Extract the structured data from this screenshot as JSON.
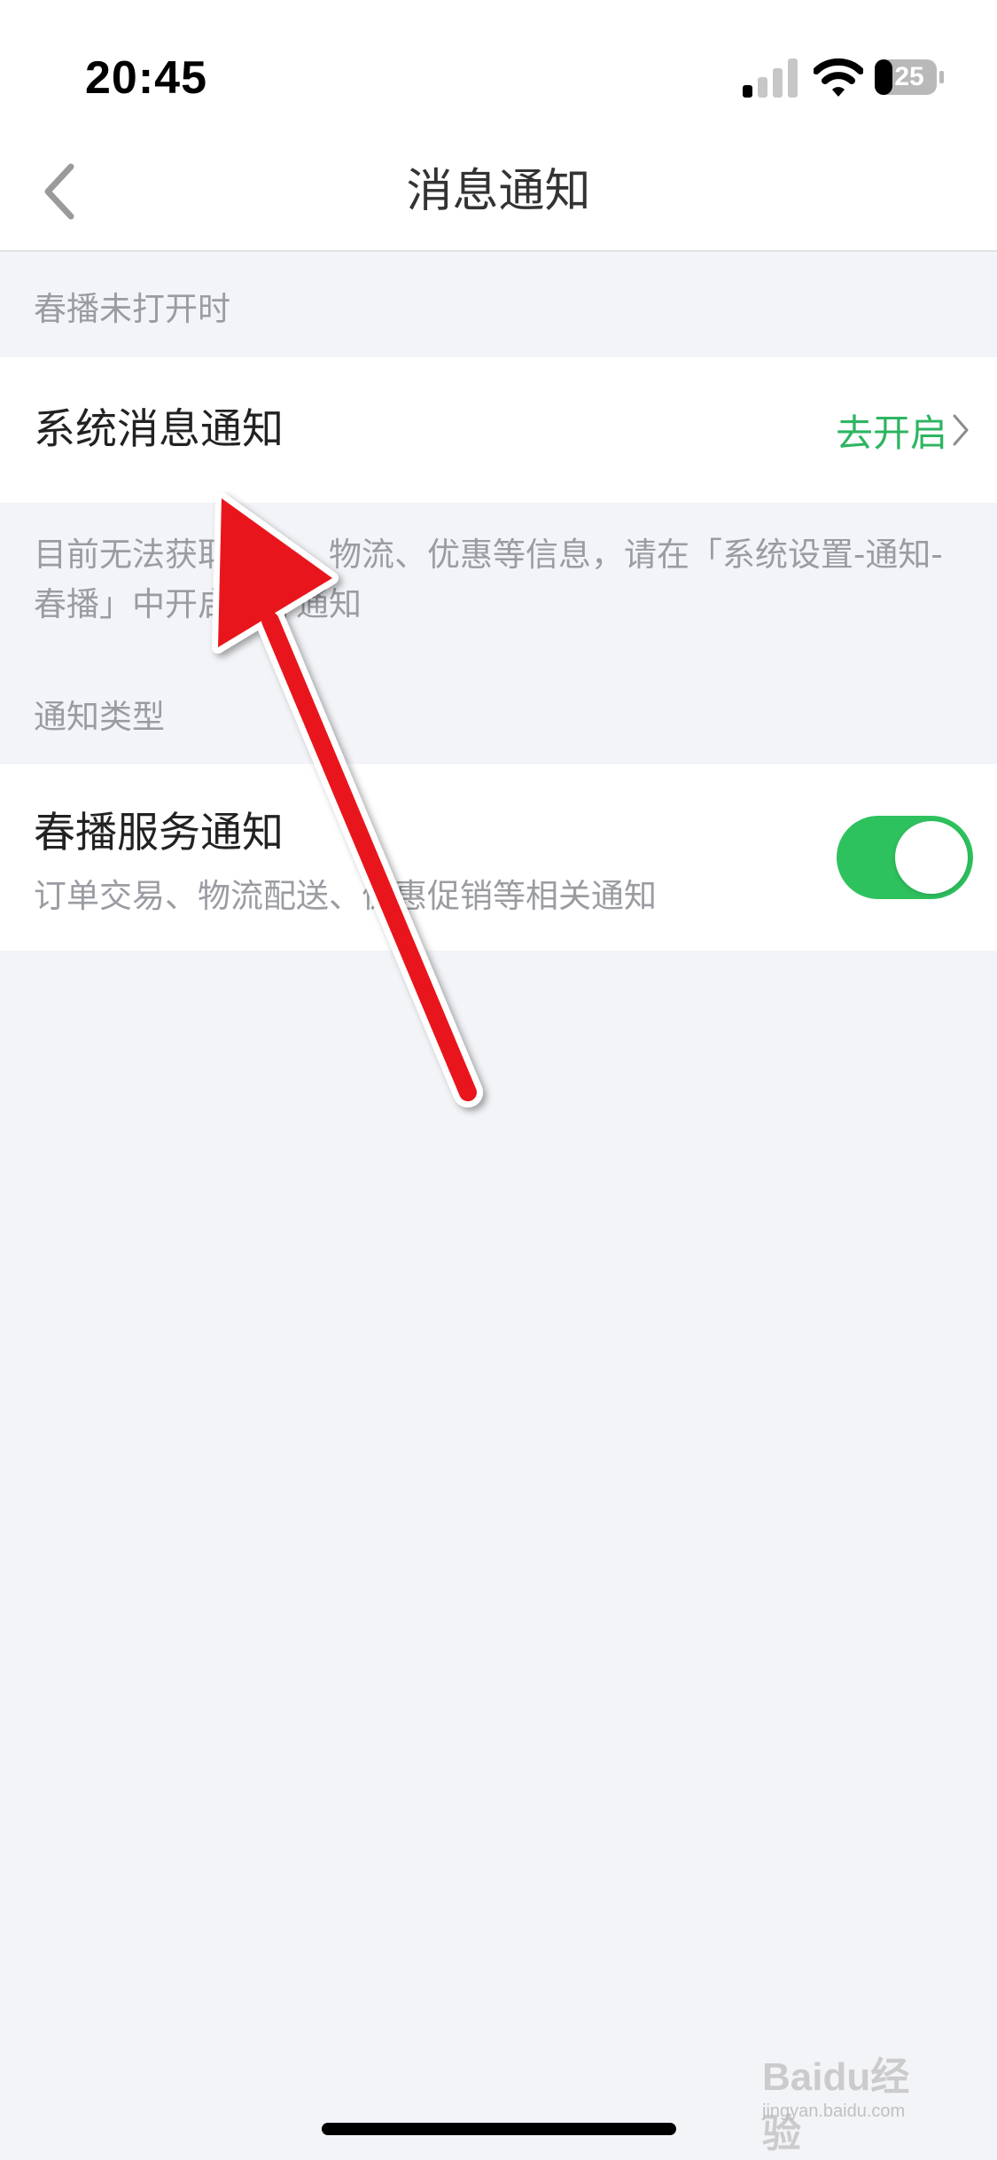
{
  "status_bar": {
    "time": "20:45",
    "battery_level": "25",
    "signal_icon": "cellular-signal-icon",
    "wifi_icon": "wifi-icon",
    "battery_icon": "battery-icon"
  },
  "nav": {
    "title": "消息通知",
    "back_icon": "chevron-left-icon"
  },
  "sections": {
    "section1_header": "春播未打开时",
    "system_notice": {
      "title": "系统消息通知",
      "action_label": "去开启",
      "action_icon": "chevron-right-icon"
    },
    "description": "目前无法获取订单、物流、优惠等信息，请在「系统设置-通知-春播」中开启允许通知",
    "section2_header": "通知类型",
    "service_notice": {
      "title": "春播服务通知",
      "subtitle": "订单交易、物流配送、优惠促销等相关通知",
      "toggle_on": true
    }
  },
  "colors": {
    "accent_green": "#2db561",
    "toggle_green": "#2ec25e",
    "arrow_red": "#e8141b",
    "background": "#f3f4f8"
  },
  "watermark": {
    "logo": "Baidu经验",
    "sub": "jingyan.baidu.com"
  }
}
